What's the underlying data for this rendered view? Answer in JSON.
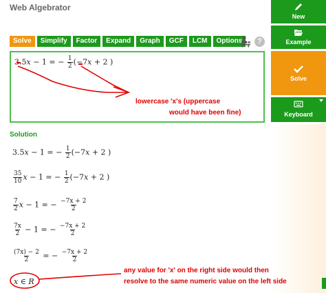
{
  "app": {
    "title": "Web Algebrator"
  },
  "tabs": [
    {
      "label": "Solve",
      "active": true
    },
    {
      "label": "Simplify"
    },
    {
      "label": "Factor"
    },
    {
      "label": "Expand"
    },
    {
      "label": "Graph"
    },
    {
      "label": "GCF"
    },
    {
      "label": "LCM"
    },
    {
      "label": "Options"
    }
  ],
  "help": {
    "glyph": "?",
    "icon": "help-icon",
    "person_icon": "person-desk-icon"
  },
  "sidebar": {
    "new": {
      "label": "New",
      "icon": "pencil-icon"
    },
    "example": {
      "label": "Example",
      "icon": "folder-open-icon"
    },
    "solve": {
      "label": "Solve",
      "icon": "checkmark-icon"
    },
    "keyboard": {
      "label": "Keyboard",
      "icon": "keyboard-icon"
    }
  },
  "input": {
    "lhs": "3.5",
    "var": "x",
    "minus_one": " − 1 = −",
    "half_num": "1",
    "half_den": "2",
    "paren_open": "(−7",
    "paren_close": " + 2 )"
  },
  "solution": {
    "label": "Solution",
    "steps": {
      "s1": {
        "a": "3.5",
        "v": "x",
        "b": " − 1 = −",
        "fn": "1",
        "fd": "2",
        "c": "(−7",
        "v2": "x",
        "d": " + 2 )"
      },
      "s2": {
        "fn": "35",
        "fd": "10",
        "v": "x",
        "b": " − 1 = −",
        "fn2": "1",
        "fd2": "2",
        "c": "(−7",
        "v2": "x",
        "d": " + 2 )"
      },
      "s3": {
        "fn": "7",
        "fd": "2",
        "v": "x",
        "b": " − 1 = −",
        "rn": "−7x + 2",
        "rd": "2"
      },
      "s4": {
        "fn": "7x",
        "fd": "2",
        "b": " − 1 = −",
        "rn": "−7x + 2",
        "rd": "2"
      },
      "s5": {
        "ln": "(7x) − 2",
        "ld": "2",
        "b": " = −",
        "rn": "−7x + 2",
        "rd": "2"
      },
      "s6": {
        "v": "x",
        "sym": " ∈ ",
        "set": "R"
      }
    }
  },
  "annotations": {
    "note1_line1": "lowercase 'x's (uppercase",
    "note1_line2": "would have been fine)",
    "note2_line1": "any value for 'x' on the right side would then",
    "note2_line2": "resolve to the same numeric value on the left side"
  },
  "colors": {
    "green": "#1c9a1c",
    "orange": "#f0960f",
    "ink_red": "#e00000",
    "border_green": "#4cbf4c"
  }
}
